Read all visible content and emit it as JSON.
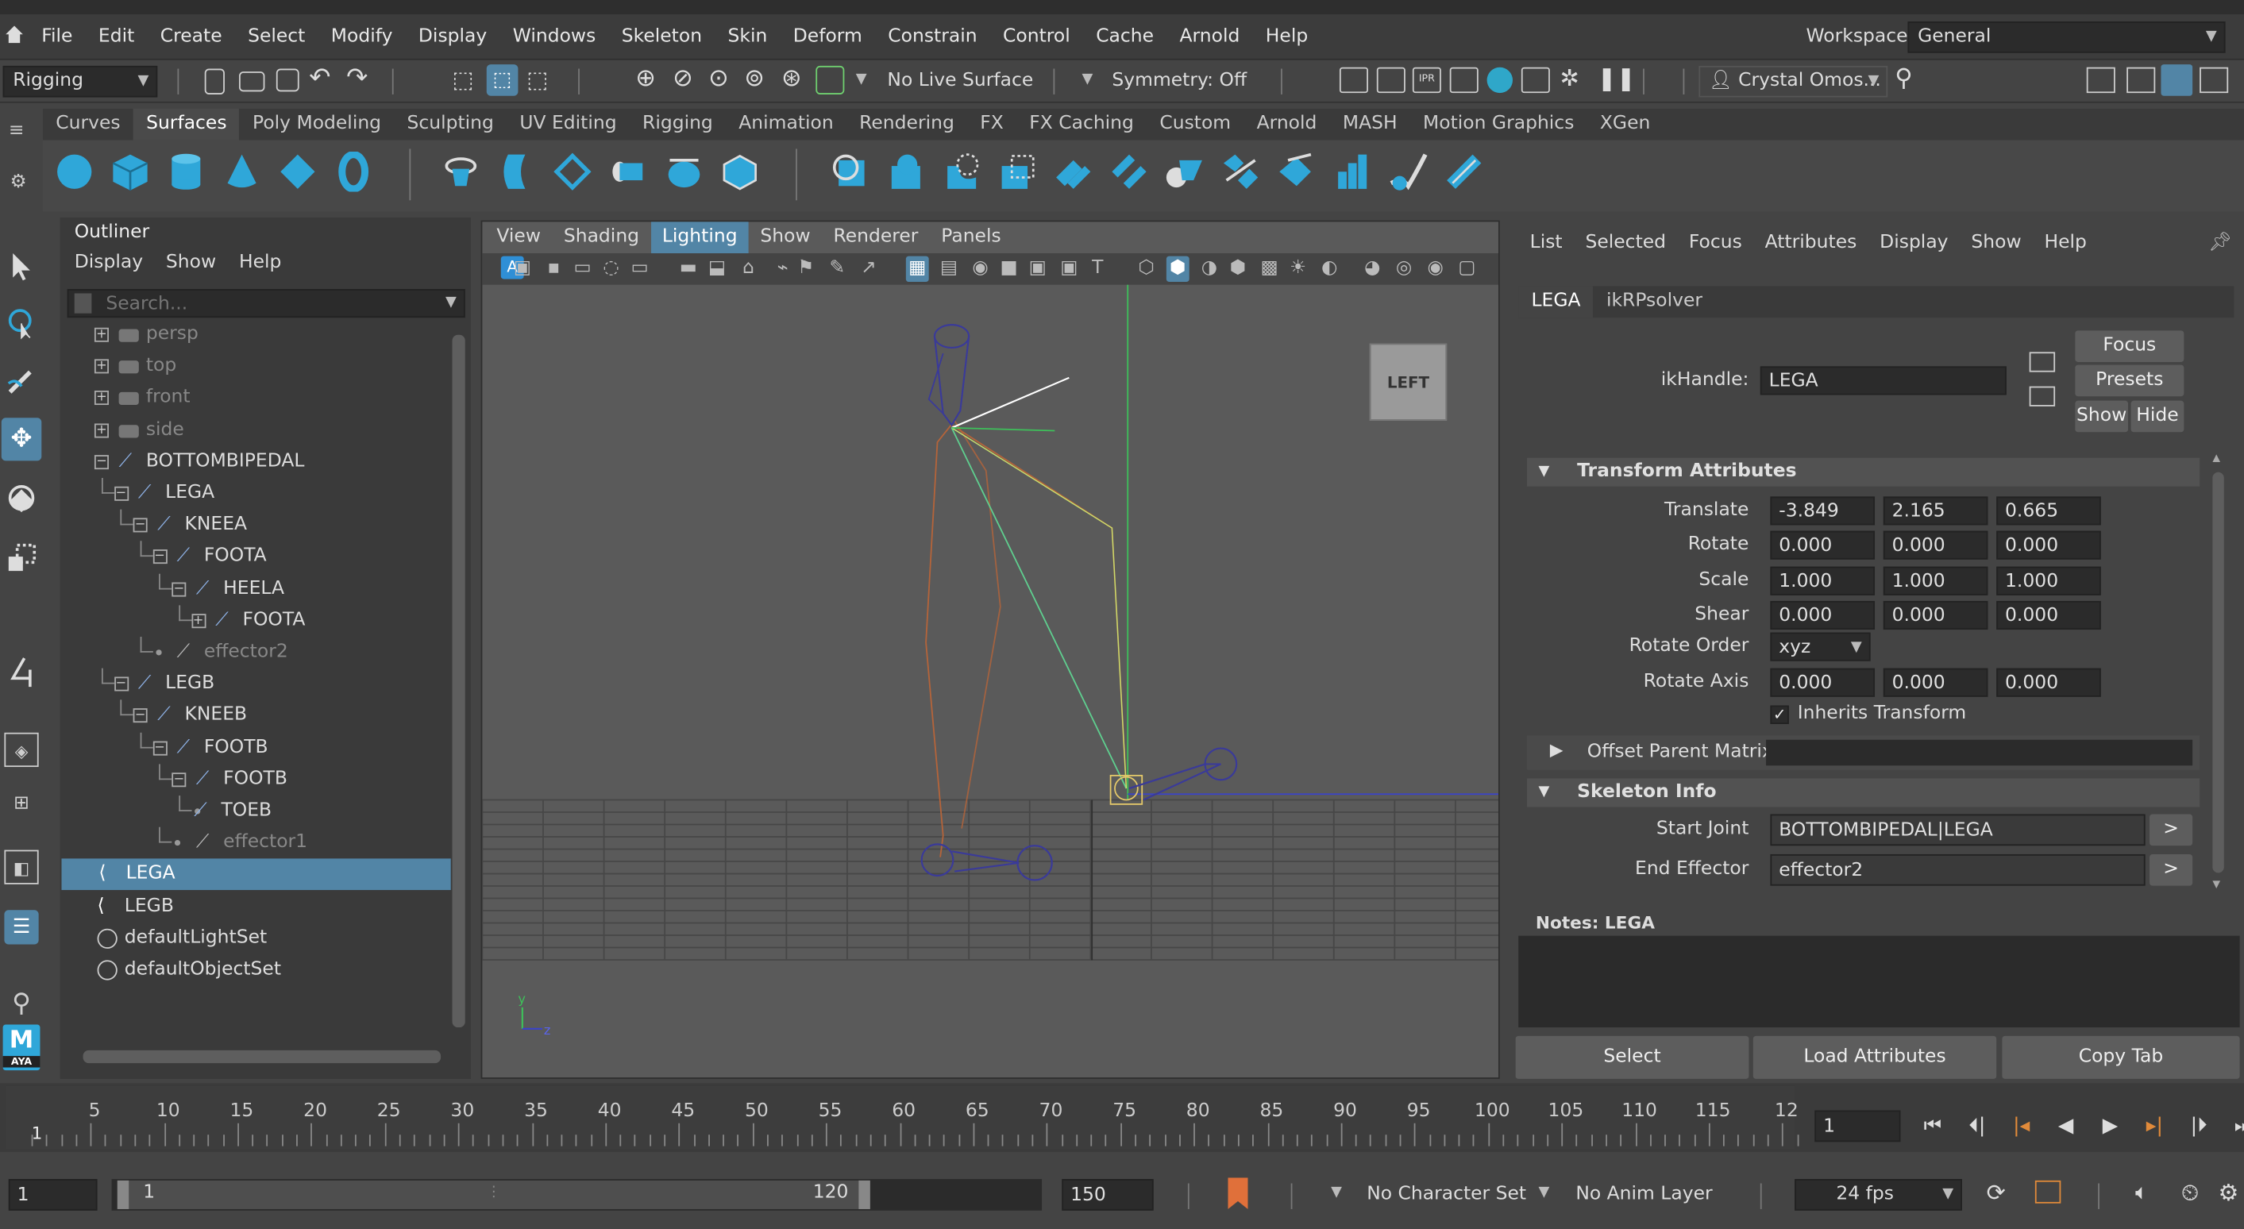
{
  "menubar": {
    "items": [
      "File",
      "Edit",
      "Create",
      "Select",
      "Modify",
      "Display",
      "Windows",
      "Skeleton",
      "Skin",
      "Deform",
      "Constrain",
      "Control",
      "Cache",
      "Arnold",
      "Help"
    ],
    "workspace_label": "Workspace:",
    "workspace_value": "General"
  },
  "statusline": {
    "menuset": "Rigging",
    "live_surface": "No Live Surface",
    "symmetry": "Symmetry: Off",
    "user": "Crystal Omos..."
  },
  "shelf": {
    "tabs": [
      "Curves",
      "Surfaces",
      "Poly Modeling",
      "Sculpting",
      "UV Editing",
      "Rigging",
      "Animation",
      "Rendering",
      "FX",
      "FX Caching",
      "Custom",
      "Arnold",
      "MASH",
      "Motion Graphics",
      "XGen"
    ],
    "active_tab": "Surfaces"
  },
  "outliner": {
    "title": "Outliner",
    "menus": [
      "Display",
      "Show",
      "Help"
    ],
    "search_placeholder": "Search...",
    "items": [
      {
        "label": "persp",
        "type": "camera",
        "depth": 0,
        "exp": "+"
      },
      {
        "label": "top",
        "type": "camera",
        "depth": 0,
        "exp": "+"
      },
      {
        "label": "front",
        "type": "camera",
        "depth": 0,
        "exp": "+"
      },
      {
        "label": "side",
        "type": "camera",
        "depth": 0,
        "exp": "+"
      },
      {
        "label": "BOTTOMBIPEDAL",
        "type": "joint",
        "depth": 0,
        "exp": "-"
      },
      {
        "label": "LEGA",
        "type": "joint",
        "depth": 1,
        "exp": "-"
      },
      {
        "label": "KNEEA",
        "type": "joint",
        "depth": 2,
        "exp": "-"
      },
      {
        "label": "FOOTA",
        "type": "joint",
        "depth": 3,
        "exp": "-"
      },
      {
        "label": "HEELA",
        "type": "joint",
        "depth": 4,
        "exp": "-"
      },
      {
        "label": "FOOTA",
        "type": "joint",
        "depth": 5,
        "exp": "+"
      },
      {
        "label": "effector2",
        "type": "effector",
        "depth": 3,
        "exp": ""
      },
      {
        "label": "LEGB",
        "type": "joint",
        "depth": 1,
        "exp": "-"
      },
      {
        "label": "KNEEB",
        "type": "joint",
        "depth": 2,
        "exp": "-"
      },
      {
        "label": "FOOTB",
        "type": "joint",
        "depth": 3,
        "exp": "-"
      },
      {
        "label": "FOOTB",
        "type": "joint",
        "depth": 4,
        "exp": "-"
      },
      {
        "label": "TOEB",
        "type": "joint",
        "depth": 5,
        "exp": ""
      },
      {
        "label": "effector1",
        "type": "effector",
        "depth": 4,
        "exp": ""
      },
      {
        "label": "LEGA",
        "type": "ik",
        "depth": 0,
        "exp": "",
        "selected": true
      },
      {
        "label": "LEGB",
        "type": "ik",
        "depth": 0,
        "exp": ""
      },
      {
        "label": "defaultLightSet",
        "type": "set",
        "depth": 0,
        "exp": ""
      },
      {
        "label": "defaultObjectSet",
        "type": "set",
        "depth": 0,
        "exp": ""
      }
    ]
  },
  "viewport": {
    "menus": [
      "View",
      "Shading",
      "Lighting",
      "Show",
      "Renderer",
      "Panels"
    ],
    "active_menu": "Lighting",
    "view_cube": "LEFT",
    "axis_y": "y",
    "axis_z": "z"
  },
  "attr_editor": {
    "menus": [
      "List",
      "Selected",
      "Focus",
      "Attributes",
      "Display",
      "Show",
      "Help"
    ],
    "tabs": [
      "LEGA",
      "ikRPsolver"
    ],
    "node_type_label": "ikHandle:",
    "node_name": "LEGA",
    "side_buttons": {
      "focus": "Focus",
      "presets": "Presets",
      "show": "Show",
      "hide": "Hide"
    },
    "transform_section": "Transform Attributes",
    "translate_label": "Translate",
    "translate": [
      "-3.849",
      "2.165",
      "0.665"
    ],
    "rotate_label": "Rotate",
    "rotate": [
      "0.000",
      "0.000",
      "0.000"
    ],
    "scale_label": "Scale",
    "scale": [
      "1.000",
      "1.000",
      "1.000"
    ],
    "shear_label": "Shear",
    "shear": [
      "0.000",
      "0.000",
      "0.000"
    ],
    "rotate_order_label": "Rotate Order",
    "rotate_order": "xyz",
    "rotate_axis_label": "Rotate Axis",
    "rotate_axis": [
      "0.000",
      "0.000",
      "0.000"
    ],
    "inherits_label": "Inherits Transform",
    "offset_section": "Offset Parent Matrix",
    "skeleton_section": "Skeleton Info",
    "start_joint_label": "Start Joint",
    "start_joint": "BOTTOMBIPEDAL|LEGA",
    "end_effector_label": "End Effector",
    "end_effector": "effector2",
    "notes_label": "Notes:  LEGA",
    "bottom_buttons": [
      "Select",
      "Load Attributes",
      "Copy Tab"
    ]
  },
  "timeline": {
    "ticks": [
      "5",
      "10",
      "15",
      "20",
      "25",
      "30",
      "35",
      "40",
      "45",
      "50",
      "55",
      "60",
      "65",
      "70",
      "75",
      "80",
      "85",
      "90",
      "95",
      "100",
      "105",
      "110",
      "115",
      "12"
    ],
    "current_frame_marker": "1",
    "current_frame": "1"
  },
  "rangebar": {
    "start": "1",
    "range_start": "1",
    "range_end": "120",
    "end": "150",
    "character_set": "No Character Set",
    "anim_layer": "No Anim Layer",
    "fps": "24 fps"
  },
  "colors": {
    "selection": "#5285a6",
    "joint_icon": "#8fb3e8",
    "ik_line": "#5fcf8f",
    "rig_orange": "#b5643a"
  }
}
